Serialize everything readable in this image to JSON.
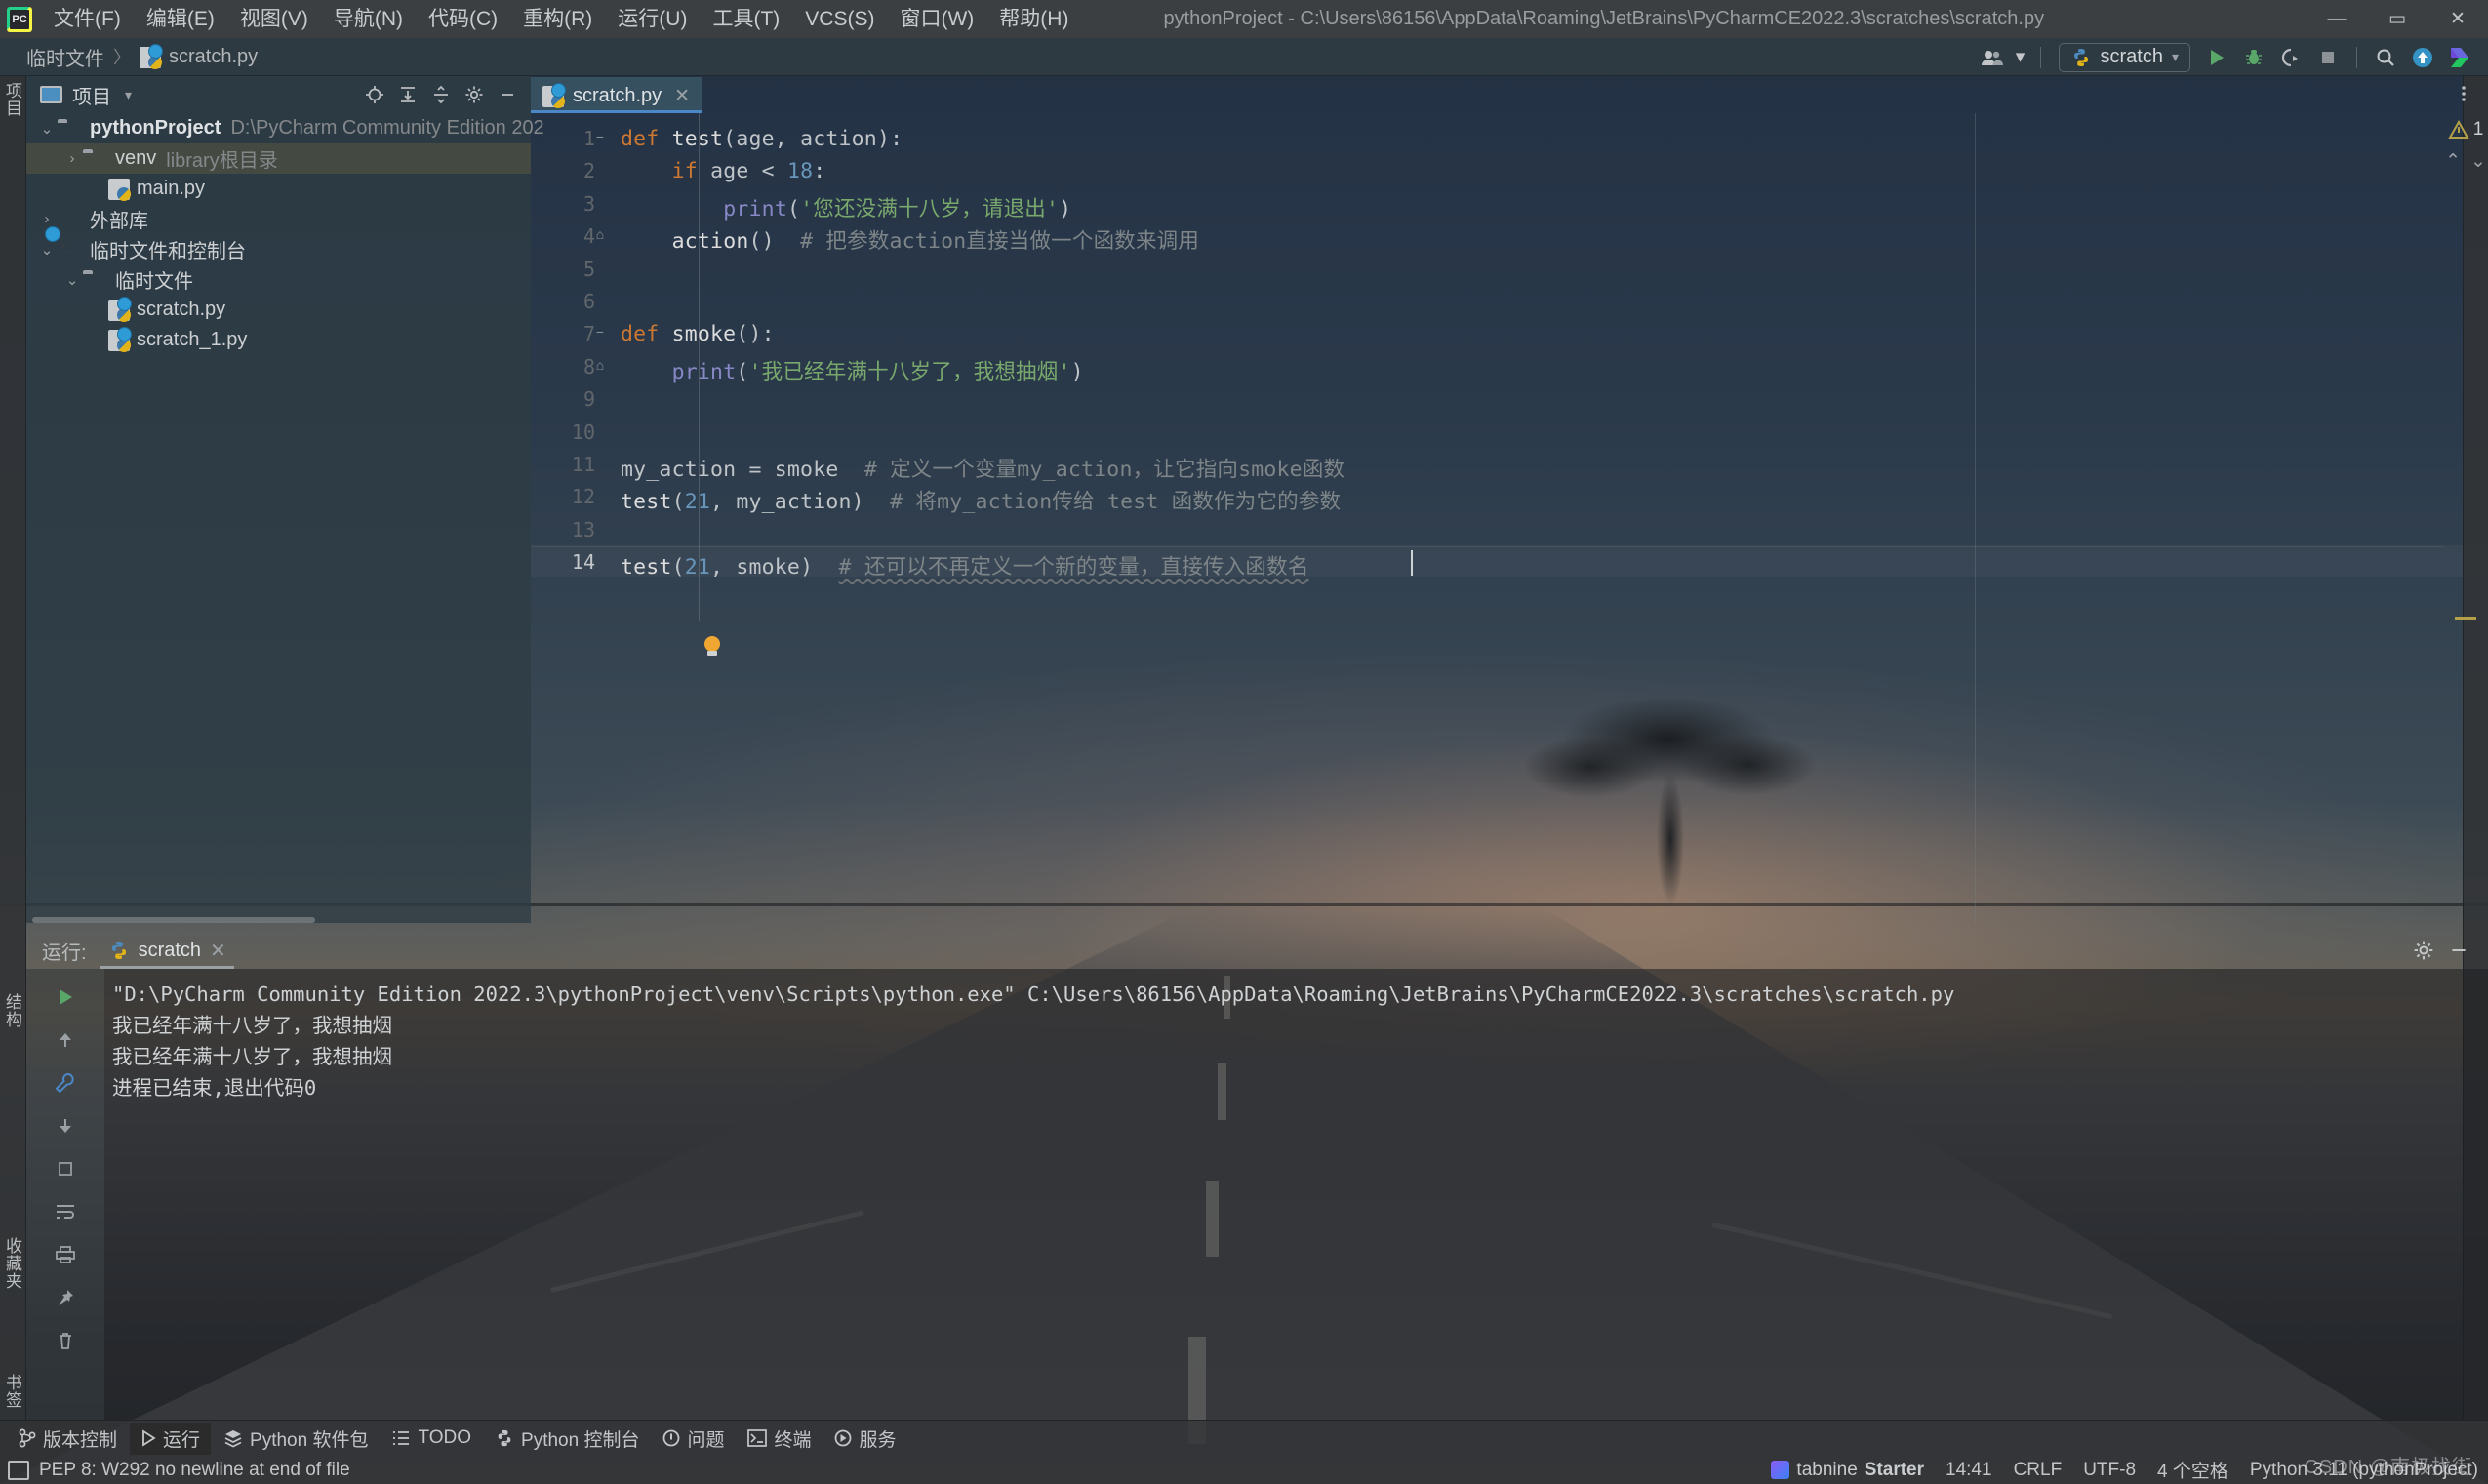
{
  "app": {
    "logo": "pycharm-logo",
    "window_title": "pythonProject - C:\\Users\\86156\\AppData\\Roaming\\JetBrains\\PyCharmCE2022.3\\scratches\\scratch.py"
  },
  "menu": [
    {
      "label": "文件(F)"
    },
    {
      "label": "编辑(E)"
    },
    {
      "label": "视图(V)"
    },
    {
      "label": "导航(N)"
    },
    {
      "label": "代码(C)"
    },
    {
      "label": "重构(R)"
    },
    {
      "label": "运行(U)"
    },
    {
      "label": "工具(T)"
    },
    {
      "label": "VCS(S)"
    },
    {
      "label": "窗口(W)"
    },
    {
      "label": "帮助(H)"
    }
  ],
  "window_buttons": {
    "minimize": "—",
    "maximize": "▭",
    "close": "✕"
  },
  "breadcrumb": {
    "root": "临时文件",
    "separator": "〉",
    "file": "scratch.py",
    "file_icon": "scratch-python-file-icon"
  },
  "toolbar": {
    "account_icon": "user-accounts-icon",
    "account_caret": "▾",
    "run_config_name": "scratch",
    "run_config_icon": "python-icon",
    "run_config_caret": "▾",
    "run": "▶",
    "debug": "debug-bug-icon",
    "run_coverage": "run-with-coverage-icon",
    "stop": "■",
    "search": "search-icon",
    "updates": "update-arrow-icon",
    "feedback": "jetbrains-toolbox-icon"
  },
  "left_stripe": [
    {
      "label": "项目",
      "name": "stripe-project"
    },
    {
      "label": "结构",
      "name": "stripe-structure"
    },
    {
      "label": "收藏夹",
      "name": "stripe-favorites"
    },
    {
      "label": "书签",
      "name": "stripe-bookmarks"
    }
  ],
  "project": {
    "title": "项目",
    "title_caret": "▾",
    "header_icons": [
      "locate-file-icon",
      "expand-all-icon",
      "collapse-all-icon",
      "settings-gear-icon",
      "hide-minimize-icon"
    ],
    "tree": [
      {
        "indent": 0,
        "arrow": "⌄",
        "icon": "folder",
        "label": "pythonProject",
        "bold": true,
        "hint": "D:\\PyCharm Community Edition 202",
        "selected": false
      },
      {
        "indent": 1,
        "arrow": "›",
        "icon": "folder",
        "label": "venv",
        "bold": false,
        "hint": "library根目录",
        "selected": true
      },
      {
        "indent": 2,
        "arrow": "",
        "icon": "python-file",
        "label": "main.py",
        "bold": false,
        "hint": "",
        "selected": false
      },
      {
        "indent": 0,
        "arrow": "›",
        "icon": "external-libraries",
        "label": "外部库",
        "bold": false,
        "hint": "",
        "selected": false
      },
      {
        "indent": 0,
        "arrow": "⌄",
        "icon": "scratches-console",
        "label": "临时文件和控制台",
        "bold": false,
        "hint": "",
        "selected": false
      },
      {
        "indent": 1,
        "arrow": "⌄",
        "icon": "folder",
        "label": "临时文件",
        "bold": false,
        "hint": "",
        "selected": false
      },
      {
        "indent": 2,
        "arrow": "",
        "icon": "scratch-file",
        "label": "scratch.py",
        "bold": false,
        "hint": "",
        "selected": false
      },
      {
        "indent": 2,
        "arrow": "",
        "icon": "scratch-file",
        "label": "scratch_1.py",
        "bold": false,
        "hint": "",
        "selected": false
      }
    ]
  },
  "editor": {
    "tabs": [
      {
        "label": "scratch.py",
        "icon": "scratch-python-file-icon",
        "active": true,
        "close": "✕"
      }
    ],
    "tab_right_icons": [
      "more-options-icon"
    ],
    "inspection": {
      "warning_icon": "warning-triangle-icon",
      "warning_count": "1",
      "prev": "⌃",
      "next": "⌄"
    },
    "lines": [
      {
        "n": "1",
        "fold": "−",
        "text": "def test(age, action):"
      },
      {
        "n": "2",
        "fold": "",
        "text": "    if age < 18:"
      },
      {
        "n": "3",
        "fold": "",
        "text": "        print('您还没满十八岁，请退出')"
      },
      {
        "n": "4",
        "fold": "⌂",
        "text": "    action()  # 把参数action直接当做一个函数来调用"
      },
      {
        "n": "5",
        "fold": "",
        "text": ""
      },
      {
        "n": "6",
        "fold": "",
        "text": ""
      },
      {
        "n": "7",
        "fold": "−",
        "text": "def smoke():"
      },
      {
        "n": "8",
        "fold": "⌂",
        "text": "    print('我已经年满十八岁了，我想抽烟')"
      },
      {
        "n": "9",
        "fold": "",
        "text": ""
      },
      {
        "n": "10",
        "fold": "",
        "text": ""
      },
      {
        "n": "11",
        "fold": "",
        "text": "my_action = smoke  # 定义一个变量my_action，让它指向smoke函数"
      },
      {
        "n": "12",
        "fold": "",
        "text": "test(21, my_action)  # 将my_action传给 test 函数作为它的参数"
      },
      {
        "n": "13",
        "fold": "",
        "text": ""
      },
      {
        "n": "14",
        "fold": "",
        "text": "test(21, smoke)  # 还可以不再定义一个新的变量，直接传入函数名"
      }
    ],
    "bulb_icon": "intention-bulb-icon"
  },
  "run_window": {
    "label": "运行:",
    "tab": {
      "label": "scratch",
      "icon": "python-icon",
      "close": "✕"
    },
    "header_icons": [
      "settings-gear-icon",
      "hide-minimize-icon"
    ],
    "side_icons": [
      "rerun-play-icon",
      "scroll-up-icon",
      "wrench-icon",
      "scroll-down-icon",
      "stop-square-icon",
      "soft-wrap-icon",
      "print-icon",
      "pin-icon",
      "trash-icon"
    ],
    "console": [
      "\"D:\\PyCharm Community Edition 2022.3\\pythonProject\\venv\\Scripts\\python.exe\" C:\\Users\\86156\\AppData\\Roaming\\JetBrains\\PyCharmCE2022.3\\scratches\\scratch.py",
      "我已经年满十八岁了，我想抽烟",
      "我已经年满十八岁了，我想抽烟",
      "",
      "进程已结束,退出代码0"
    ]
  },
  "tool_windows": [
    {
      "label": "版本控制",
      "icon": "branch-icon",
      "active": false
    },
    {
      "label": "运行",
      "icon": "play-icon",
      "active": true
    },
    {
      "label": "Python 软件包",
      "icon": "packages-icon",
      "active": false
    },
    {
      "label": "TODO",
      "icon": "todo-list-icon",
      "active": false
    },
    {
      "label": "Python 控制台",
      "icon": "python-icon",
      "active": false
    },
    {
      "label": "问题",
      "icon": "problems-icon",
      "active": false
    },
    {
      "label": "终端",
      "icon": "terminal-icon",
      "active": false
    },
    {
      "label": "服务",
      "icon": "services-icon",
      "active": false
    }
  ],
  "status_bar": {
    "message_icon": "inspection-icon",
    "message": "PEP 8: W292 no newline at end of file",
    "tabnine": {
      "name": "tabnine",
      "tier": "Starter",
      "icon": "tabnine-icon"
    },
    "items": [
      {
        "label": "14:41",
        "name": "caret-position"
      },
      {
        "label": "CRLF",
        "name": "line-separator"
      },
      {
        "label": "UTF-8",
        "name": "file-encoding"
      },
      {
        "label": "4 个空格",
        "name": "indent-setting"
      },
      {
        "label": "Python 3.11 (pythonProject)",
        "name": "python-interpreter"
      }
    ]
  },
  "watermark": "CSDN @南极找街",
  "colors": {
    "accent": "#4a88c7",
    "keyword": "#cc7832",
    "string": "#79a86d",
    "number": "#6897bb",
    "comment": "#7e8588",
    "function": "#8888c6",
    "titlebar": "#3c3f41",
    "warning": "#b5a04a"
  }
}
